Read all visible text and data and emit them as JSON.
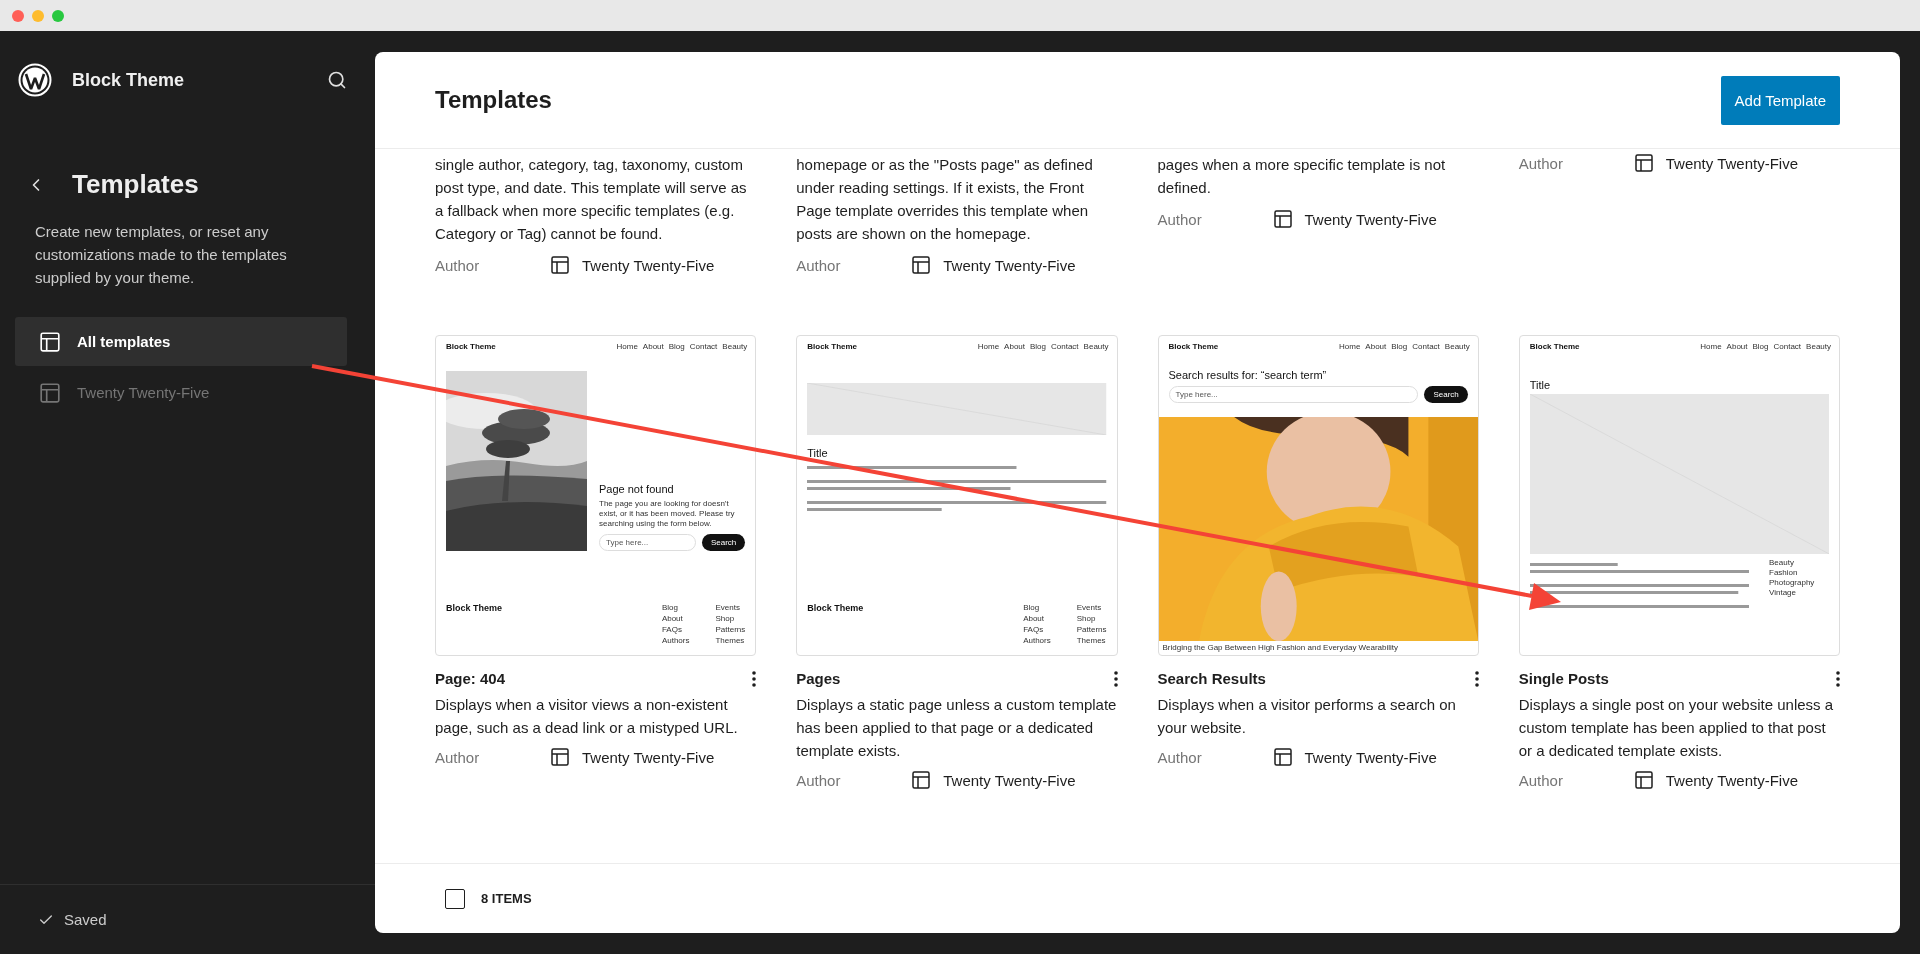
{
  "sidebar": {
    "site_title": "Block Theme",
    "heading": "Templates",
    "description": "Create new templates, or reset any customizations made to the templates supplied by your theme.",
    "items": [
      {
        "label": "All templates",
        "selected": true
      },
      {
        "label": "Twenty Twenty-Five",
        "selected": false
      }
    ],
    "status": "Saved"
  },
  "main": {
    "title": "Templates",
    "add_button": "Add Template"
  },
  "top_cards": [
    {
      "description": "single author, category, tag, taxonomy, custom post type, and date. This template will serve as a fallback when more specific templates (e.g. Category or Tag) cannot be found.",
      "author": "Author",
      "theme": "Twenty Twenty-Five"
    },
    {
      "description": "homepage or as the \"Posts page\" as defined under reading settings. If it exists, the Front Page template overrides this template when posts are shown on the homepage.",
      "author": "Author",
      "theme": "Twenty Twenty-Five"
    },
    {
      "description": "pages when a more specific template is not defined.",
      "author": "Author",
      "theme": "Twenty Twenty-Five"
    },
    {
      "author": "Author",
      "theme": "Twenty Twenty-Five"
    }
  ],
  "cards": [
    {
      "title": "Page: 404",
      "description": "Displays when a visitor views a non-existent page, such as a dead link or a mistyped URL.",
      "author": "Author",
      "theme": "Twenty Twenty-Five",
      "preview": {
        "kind": "error",
        "site": "Block Theme",
        "nav": [
          "Home",
          "About",
          "Blog",
          "Contact",
          "Beauty"
        ],
        "heading": "Page not found",
        "text": "The page you are looking for doesn't exist, or it has been moved. Please try searching using the form below.",
        "placeholder": "Type here...",
        "button": "Search",
        "footer_title": "Block Theme",
        "footer_links": [
          "Blog",
          "About",
          "FAQs",
          "Authors",
          "Events",
          "Shop",
          "Patterns",
          "Themes"
        ]
      }
    },
    {
      "title": "Pages",
      "description": "Displays a static page unless a custom template has been applied to that page or a dedicated template exists.",
      "author": "Author",
      "theme": "Twenty Twenty-Five",
      "preview": {
        "kind": "page",
        "site": "Block Theme",
        "nav": [
          "Home",
          "About",
          "Blog",
          "Contact",
          "Beauty"
        ],
        "heading": "Title",
        "footer_title": "Block Theme",
        "footer_links": [
          "Blog",
          "About",
          "FAQs",
          "Authors",
          "Events",
          "Shop",
          "Patterns",
          "Themes"
        ]
      }
    },
    {
      "title": "Search Results",
      "description": "Displays when a visitor performs a search on your website.",
      "author": "Author",
      "theme": "Twenty Twenty-Five",
      "preview": {
        "kind": "search",
        "site": "Block Theme",
        "nav": [
          "Home",
          "About",
          "Blog",
          "Contact",
          "Beauty"
        ],
        "heading": "Search results for: “search term”",
        "placeholder": "Type here...",
        "button": "Search",
        "caption": "Bridging the Gap Between High Fashion and Everyday Wearability"
      }
    },
    {
      "title": "Single Posts",
      "description": "Displays a single post on your website unless a custom template has been applied to that post or a dedicated template exists.",
      "author": "Author",
      "theme": "Twenty Twenty-Five",
      "preview": {
        "kind": "single",
        "site": "Block Theme",
        "nav": [
          "Home",
          "About",
          "Blog",
          "Contact",
          "Beauty"
        ],
        "heading": "Title",
        "tags": [
          "Beauty",
          "Fashion",
          "Photography",
          "Vintage"
        ]
      }
    }
  ],
  "footer": {
    "checked": false,
    "count": "8 ITEMS"
  }
}
